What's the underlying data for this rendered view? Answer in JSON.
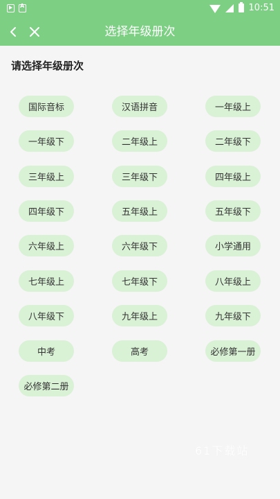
{
  "status_bar": {
    "time": "10:51"
  },
  "app_bar": {
    "title": "选择年级册次"
  },
  "section_title": "请选择年级册次",
  "grades": [
    "国际音标",
    "汉语拼音",
    "一年级上",
    "一年级下",
    "二年级上",
    "二年级下",
    "三年级上",
    "三年级下",
    "四年级上",
    "四年级下",
    "五年级上",
    "五年级下",
    "六年级上",
    "六年级下",
    "小学通用",
    "七年级上",
    "七年级下",
    "八年级上",
    "八年级下",
    "九年级上",
    "九年级下",
    "中考",
    "高考",
    "必修第一册",
    "必修第二册"
  ],
  "watermark": "61下载站",
  "colors": {
    "accent": "#7dcf83",
    "chip_bg": "#d9f1d5"
  }
}
